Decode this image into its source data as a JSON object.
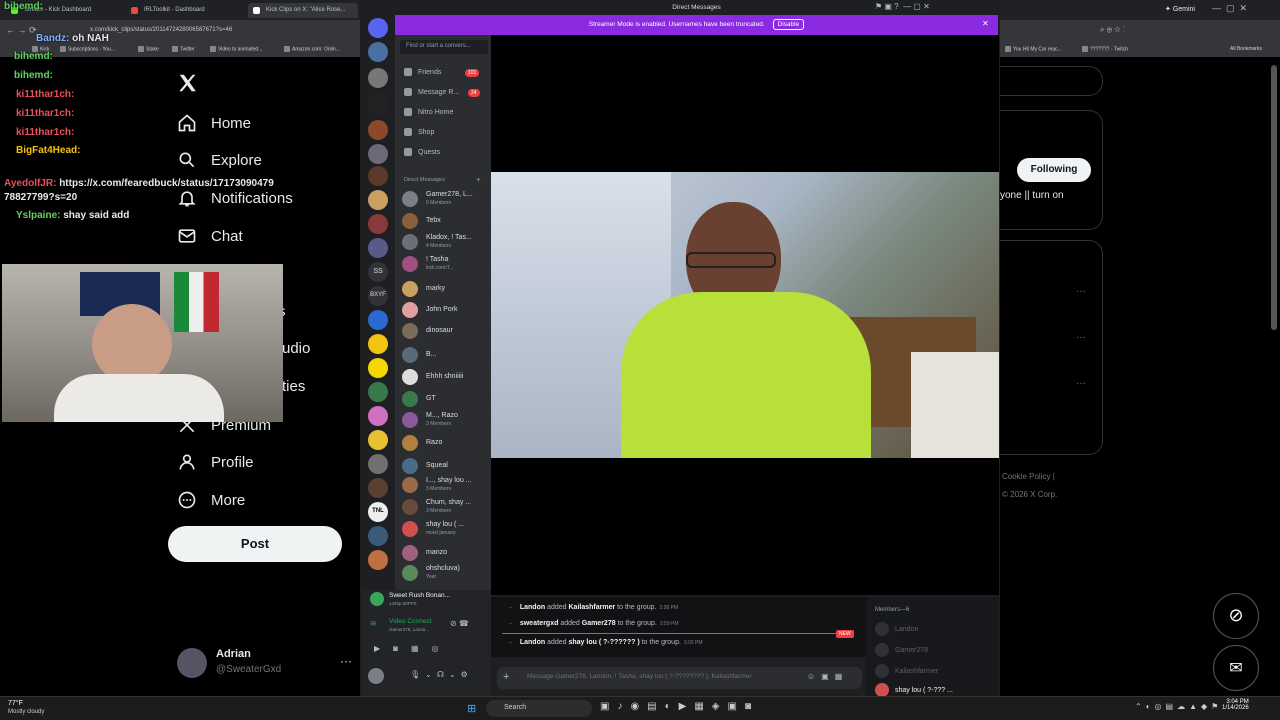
{
  "browser": {
    "tabs": [
      {
        "label": "Stream - Kick Dashboard",
        "color": "#53fc18"
      },
      {
        "label": "IRLToolkit - Dashboard",
        "color": "#e74c3c"
      },
      {
        "label": "Kick Clips on X: \"Alice Rose...",
        "color": "#ffffff"
      }
    ],
    "url": "x.com/kick_clips/status/2011472428006587671?s=46",
    "gemini_label": "Gemini",
    "bookmarks": [
      "Kick",
      "Subscriptions - You...",
      "Stake",
      "Twitter",
      "Video to animated...",
      "Amazon.com: Onlin..."
    ],
    "right_bookmarks": [
      "You Hit My Car reac...",
      "??????? - Twitch"
    ],
    "all_bookmarks_label": "All Bookmarks"
  },
  "x_sidebar": {
    "nav": [
      {
        "label": "Home",
        "icon": "home-icon"
      },
      {
        "label": "Explore",
        "icon": "search-icon"
      },
      {
        "label": "Notifications",
        "icon": "bell-icon"
      },
      {
        "label": "Chat",
        "icon": "mail-icon"
      },
      {
        "label": "Premium",
        "icon": "x-logo-icon"
      },
      {
        "label": "Profile",
        "icon": "person-icon"
      },
      {
        "label": "More",
        "icon": "more-circle-icon"
      }
    ],
    "partial_labels": [
      "s",
      "udio",
      "ties"
    ],
    "post_label": "Post",
    "user_name": "Adrian",
    "user_handle": "@SweaterGxd"
  },
  "chat_overlay": [
    {
      "user": "bihemd:",
      "text": "",
      "color": "#5fd35f"
    },
    {
      "user": "Bandz:",
      "text": "oh NAH",
      "color": "#7fb3ff"
    },
    {
      "user": "bihemd:",
      "text": "",
      "color": "#5fd35f"
    },
    {
      "user": "ki11thar1ch:",
      "text": "",
      "color": "#e8505b"
    },
    {
      "user": "ki11thar1ch:",
      "text": "",
      "color": "#e8505b"
    },
    {
      "user": "ki11thar1ch:",
      "text": "",
      "color": "#e8505b"
    },
    {
      "user": "BigFat4Head:",
      "text": "",
      "color": "#f1c40f"
    },
    {
      "user": "AyedolfJR:",
      "text": "https://x.com/fearedbuck/status/17173090479",
      "color": "#e8505b"
    },
    {
      "user": "",
      "text": "78827799?s=20",
      "color": "#ffffff"
    },
    {
      "user": "Yslpaine:",
      "text": "shay said add",
      "color": "#5fd35f"
    }
  ],
  "discord": {
    "title": "Direct Messages",
    "streamer_notice": "Streamer Mode is enabled. Usernames have been truncated.",
    "disable_label": "Disable",
    "search_placeholder": "Find or start a convers...",
    "nav": [
      {
        "label": "Friends",
        "badge": "101"
      },
      {
        "label": "Message R...",
        "badge": "24"
      },
      {
        "label": "Nitro Home",
        "badge": ""
      },
      {
        "label": "Shop",
        "badge": ""
      },
      {
        "label": "Quests",
        "badge": ""
      }
    ],
    "dm_header": "Direct Messages",
    "dms": [
      {
        "name": "Gamer278, L...",
        "sub": "6 Members",
        "color": "#7a7f88"
      },
      {
        "name": "Tebx",
        "sub": "",
        "color": "#8b5e3c"
      },
      {
        "name": "Kladox, ! Tas...",
        "sub": "4 Members",
        "color": "#6d6f78"
      },
      {
        "name": "! Tasha",
        "sub": "kick.com/T...",
        "color": "#a05080"
      },
      {
        "name": "marky",
        "sub": "",
        "color": "#c8a060"
      },
      {
        "name": "John Pork",
        "sub": "",
        "color": "#e0a0a0"
      },
      {
        "name": "dinosaur",
        "sub": "",
        "color": "#7a6b5a"
      },
      {
        "name": "B...",
        "sub": "",
        "color": "#5a6a7a"
      },
      {
        "name": "Ehhh shniiiii",
        "sub": "",
        "color": "#dddddd"
      },
      {
        "name": "GT",
        "sub": "",
        "color": "#3a7a4a"
      },
      {
        "name": "M..., Razo",
        "sub": "3 Members",
        "color": "#8a5a9a"
      },
      {
        "name": "Razo",
        "sub": "",
        "color": "#b08040"
      },
      {
        "name": "Squeal",
        "sub": "",
        "color": "#4a6a8a"
      },
      {
        "name": "I..., shay lou ...",
        "sub": "3 Members",
        "color": "#9a6a4a"
      },
      {
        "name": "Chum, shay ...",
        "sub": "3 Members",
        "color": "#6a4a3a"
      },
      {
        "name": "shay lou ( ...",
        "sub": "moist january",
        "color": "#d05050"
      },
      {
        "name": "manzo",
        "sub": "",
        "color": "#a06080"
      },
      {
        "name": "ohshcluva)",
        "sub": "Yeat",
        "color": "#5a8a5a"
      }
    ],
    "activity_title": "Sweet Rush Bonan...",
    "activity_sub": "1440p 60FPS",
    "voice_status": "Video Connect",
    "voice_sub": "Gamer278, Lando...",
    "messages": [
      {
        "who": "Landon",
        "action": "added",
        "target": "Kailashfarmer",
        "rest": "to the group.",
        "time": "2:28 PM"
      },
      {
        "who": "sweatergxd",
        "action": "added",
        "target": "Gamer278",
        "rest": "to the group.",
        "time": "2:59 PM"
      },
      {
        "who": "Landon",
        "action": "added",
        "target": "shay lou ( ?-?????? )",
        "rest": "to the group.",
        "time": "3:02 PM"
      }
    ],
    "new_label": "NEW",
    "members_header": "Members—6",
    "members": [
      "Landon",
      "Gamer278",
      "Kailashfarmer",
      "shay lou ( ?-??? ..."
    ],
    "input_placeholder": "Message Gamer278, Landon, ! Tasha, shay lou ( ?-???????? ), Kailashfarmer"
  },
  "x_right": {
    "following_label": "Following",
    "snippet": "yone || turn on",
    "footer_link": "Cookie Policy |",
    "copyright": "© 2026 X Corp."
  },
  "taskbar": {
    "weather_temp": "77°F",
    "weather_desc": "Mostly cloudy",
    "search_label": "Search",
    "time": "3:04 PM",
    "date": "1/14/2026"
  }
}
